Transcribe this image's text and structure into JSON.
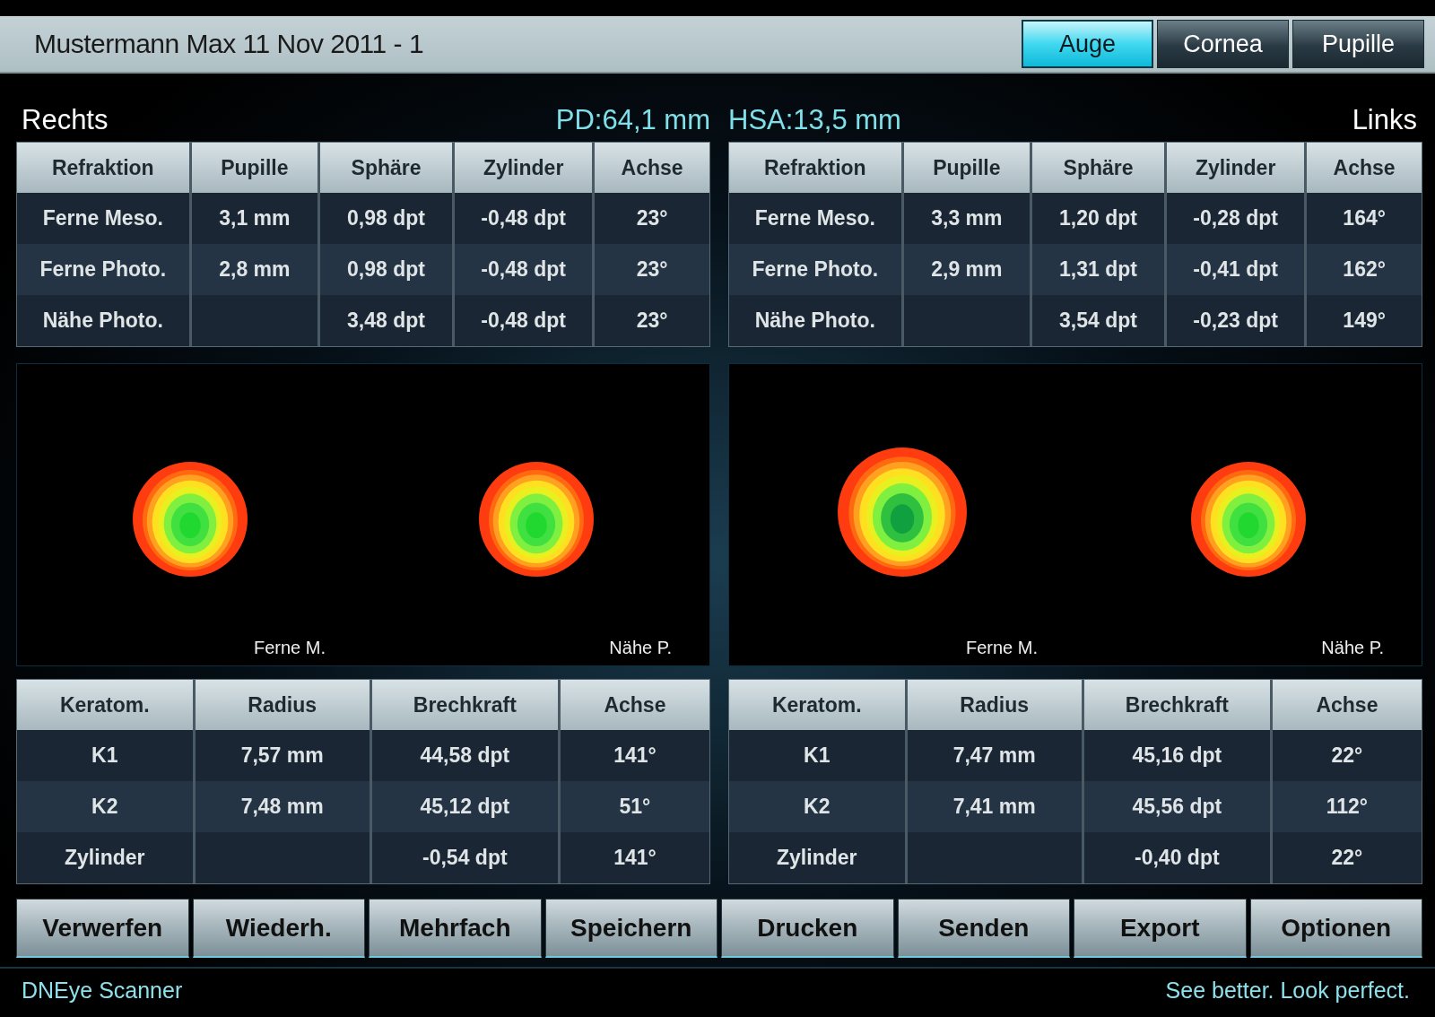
{
  "header": {
    "title": "Mustermann Max 11 Nov 2011 - 1"
  },
  "tabs": [
    {
      "label": "Auge",
      "selected": true
    },
    {
      "label": "Cornea",
      "selected": false
    },
    {
      "label": "Pupille",
      "selected": false
    }
  ],
  "eyes": [
    {
      "side": "Rechts",
      "measure": "PD:64,1 mm",
      "refraction": {
        "columns": [
          "Refraktion",
          "Pupille",
          "Sphäre",
          "Zylinder",
          "Achse"
        ],
        "rows": [
          [
            "Ferne Meso.",
            "3,1 mm",
            "0,98 dpt",
            "-0,48 dpt",
            "23°"
          ],
          [
            "Ferne Photo.",
            "2,8 mm",
            "0,98 dpt",
            "-0,48 dpt",
            "23°"
          ],
          [
            "Nähe Photo.",
            "",
            "3,48 dpt",
            "-0,48 dpt",
            "23°"
          ]
        ]
      },
      "maps": [
        {
          "label": "Ferne M."
        },
        {
          "label": "Nähe P."
        }
      ],
      "keratometry": {
        "columns": [
          "Keratom.",
          "Radius",
          "Brechkraft",
          "Achse"
        ],
        "rows": [
          [
            "K1",
            "7,57 mm",
            "44,58 dpt",
            "141°"
          ],
          [
            "K2",
            "7,48 mm",
            "45,12 dpt",
            "51°"
          ],
          [
            "Zylinder",
            "",
            "-0,54 dpt",
            "141°"
          ]
        ]
      }
    },
    {
      "side": "Links",
      "measure": "HSA:13,5 mm",
      "refraction": {
        "columns": [
          "Refraktion",
          "Pupille",
          "Sphäre",
          "Zylinder",
          "Achse"
        ],
        "rows": [
          [
            "Ferne Meso.",
            "3,3 mm",
            "1,20 dpt",
            "-0,28 dpt",
            "164°"
          ],
          [
            "Ferne Photo.",
            "2,9 mm",
            "1,31 dpt",
            "-0,41 dpt",
            "162°"
          ],
          [
            "Nähe Photo.",
            "",
            "3,54 dpt",
            "-0,23 dpt",
            "149°"
          ]
        ]
      },
      "maps": [
        {
          "label": "Ferne M."
        },
        {
          "label": "Nähe P."
        }
      ],
      "keratometry": {
        "columns": [
          "Keratom.",
          "Radius",
          "Brechkraft",
          "Achse"
        ],
        "rows": [
          [
            "K1",
            "7,47 mm",
            "45,16 dpt",
            "22°"
          ],
          [
            "K2",
            "7,41 mm",
            "45,56 dpt",
            "112°"
          ],
          [
            "Zylinder",
            "",
            "-0,40 dpt",
            "22°"
          ]
        ]
      }
    }
  ],
  "buttons": [
    "Verwerfen",
    "Wiederh.",
    "Mehrfach",
    "Speichern",
    "Drucken",
    "Senden",
    "Export",
    "Optionen"
  ],
  "status_bar": {
    "app_name": "DNEye Scanner",
    "slogan": "See better. Look perfect."
  }
}
